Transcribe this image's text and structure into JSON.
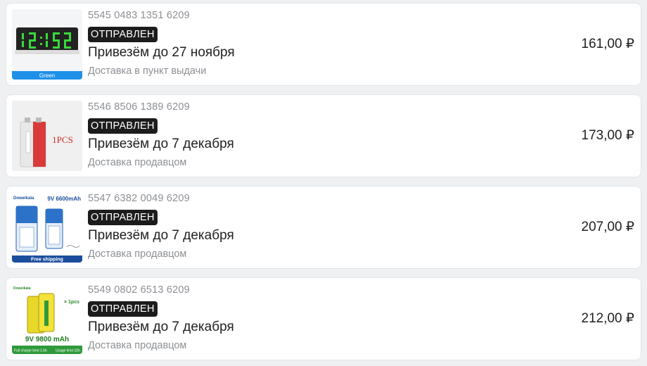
{
  "orders": [
    {
      "track": "5545 0483 1351 6209",
      "status": "ОТПРАВЛЕН",
      "title": "Привезём до 27 ноября",
      "delivery": "Доставка в пункт выдачи",
      "price": "161,00 ₽",
      "thumb_caption": "Green"
    },
    {
      "track": "5546 8506 1389 6209",
      "status": "ОТПРАВЛЕН",
      "title": "Привезём до 7 декабря",
      "delivery": "Доставка продавцом",
      "price": "173,00 ₽",
      "thumb_caption": "1PCS"
    },
    {
      "track": "5547 6382 0049 6209",
      "status": "ОТПРАВЛЕН",
      "title": "Привезём до 7 декабря",
      "delivery": "Доставка продавцом",
      "price": "207,00 ₽",
      "thumb_caption": "9V 6600mAh",
      "thumb_brand": "Doweikala",
      "thumb_footer": "Free shipping"
    },
    {
      "track": "5549 0802 6513 6209",
      "status": "ОТПРАВЛЕН",
      "title": "Привезём до 7 декабря",
      "delivery": "Доставка продавцом",
      "price": "212,00 ₽",
      "thumb_caption": "9V 9800 mAh",
      "thumb_brand": "Doweikala",
      "thumb_badge": "× 1pcs",
      "thumb_footer_left": "Full charge time:1.5h",
      "thumb_footer_right": "Usage time:10h"
    }
  ],
  "thumb_icons": [
    "digital-clock-module-icon",
    "9v-battery-icon",
    "rechargeable-9v-battery-pack-icon",
    "rechargeable-9v-battery-icon"
  ],
  "colors": {
    "background": "#eef0f2",
    "card": "#ffffff",
    "badge_bg": "#1c1c1c",
    "muted_text": "#8c8f94"
  }
}
